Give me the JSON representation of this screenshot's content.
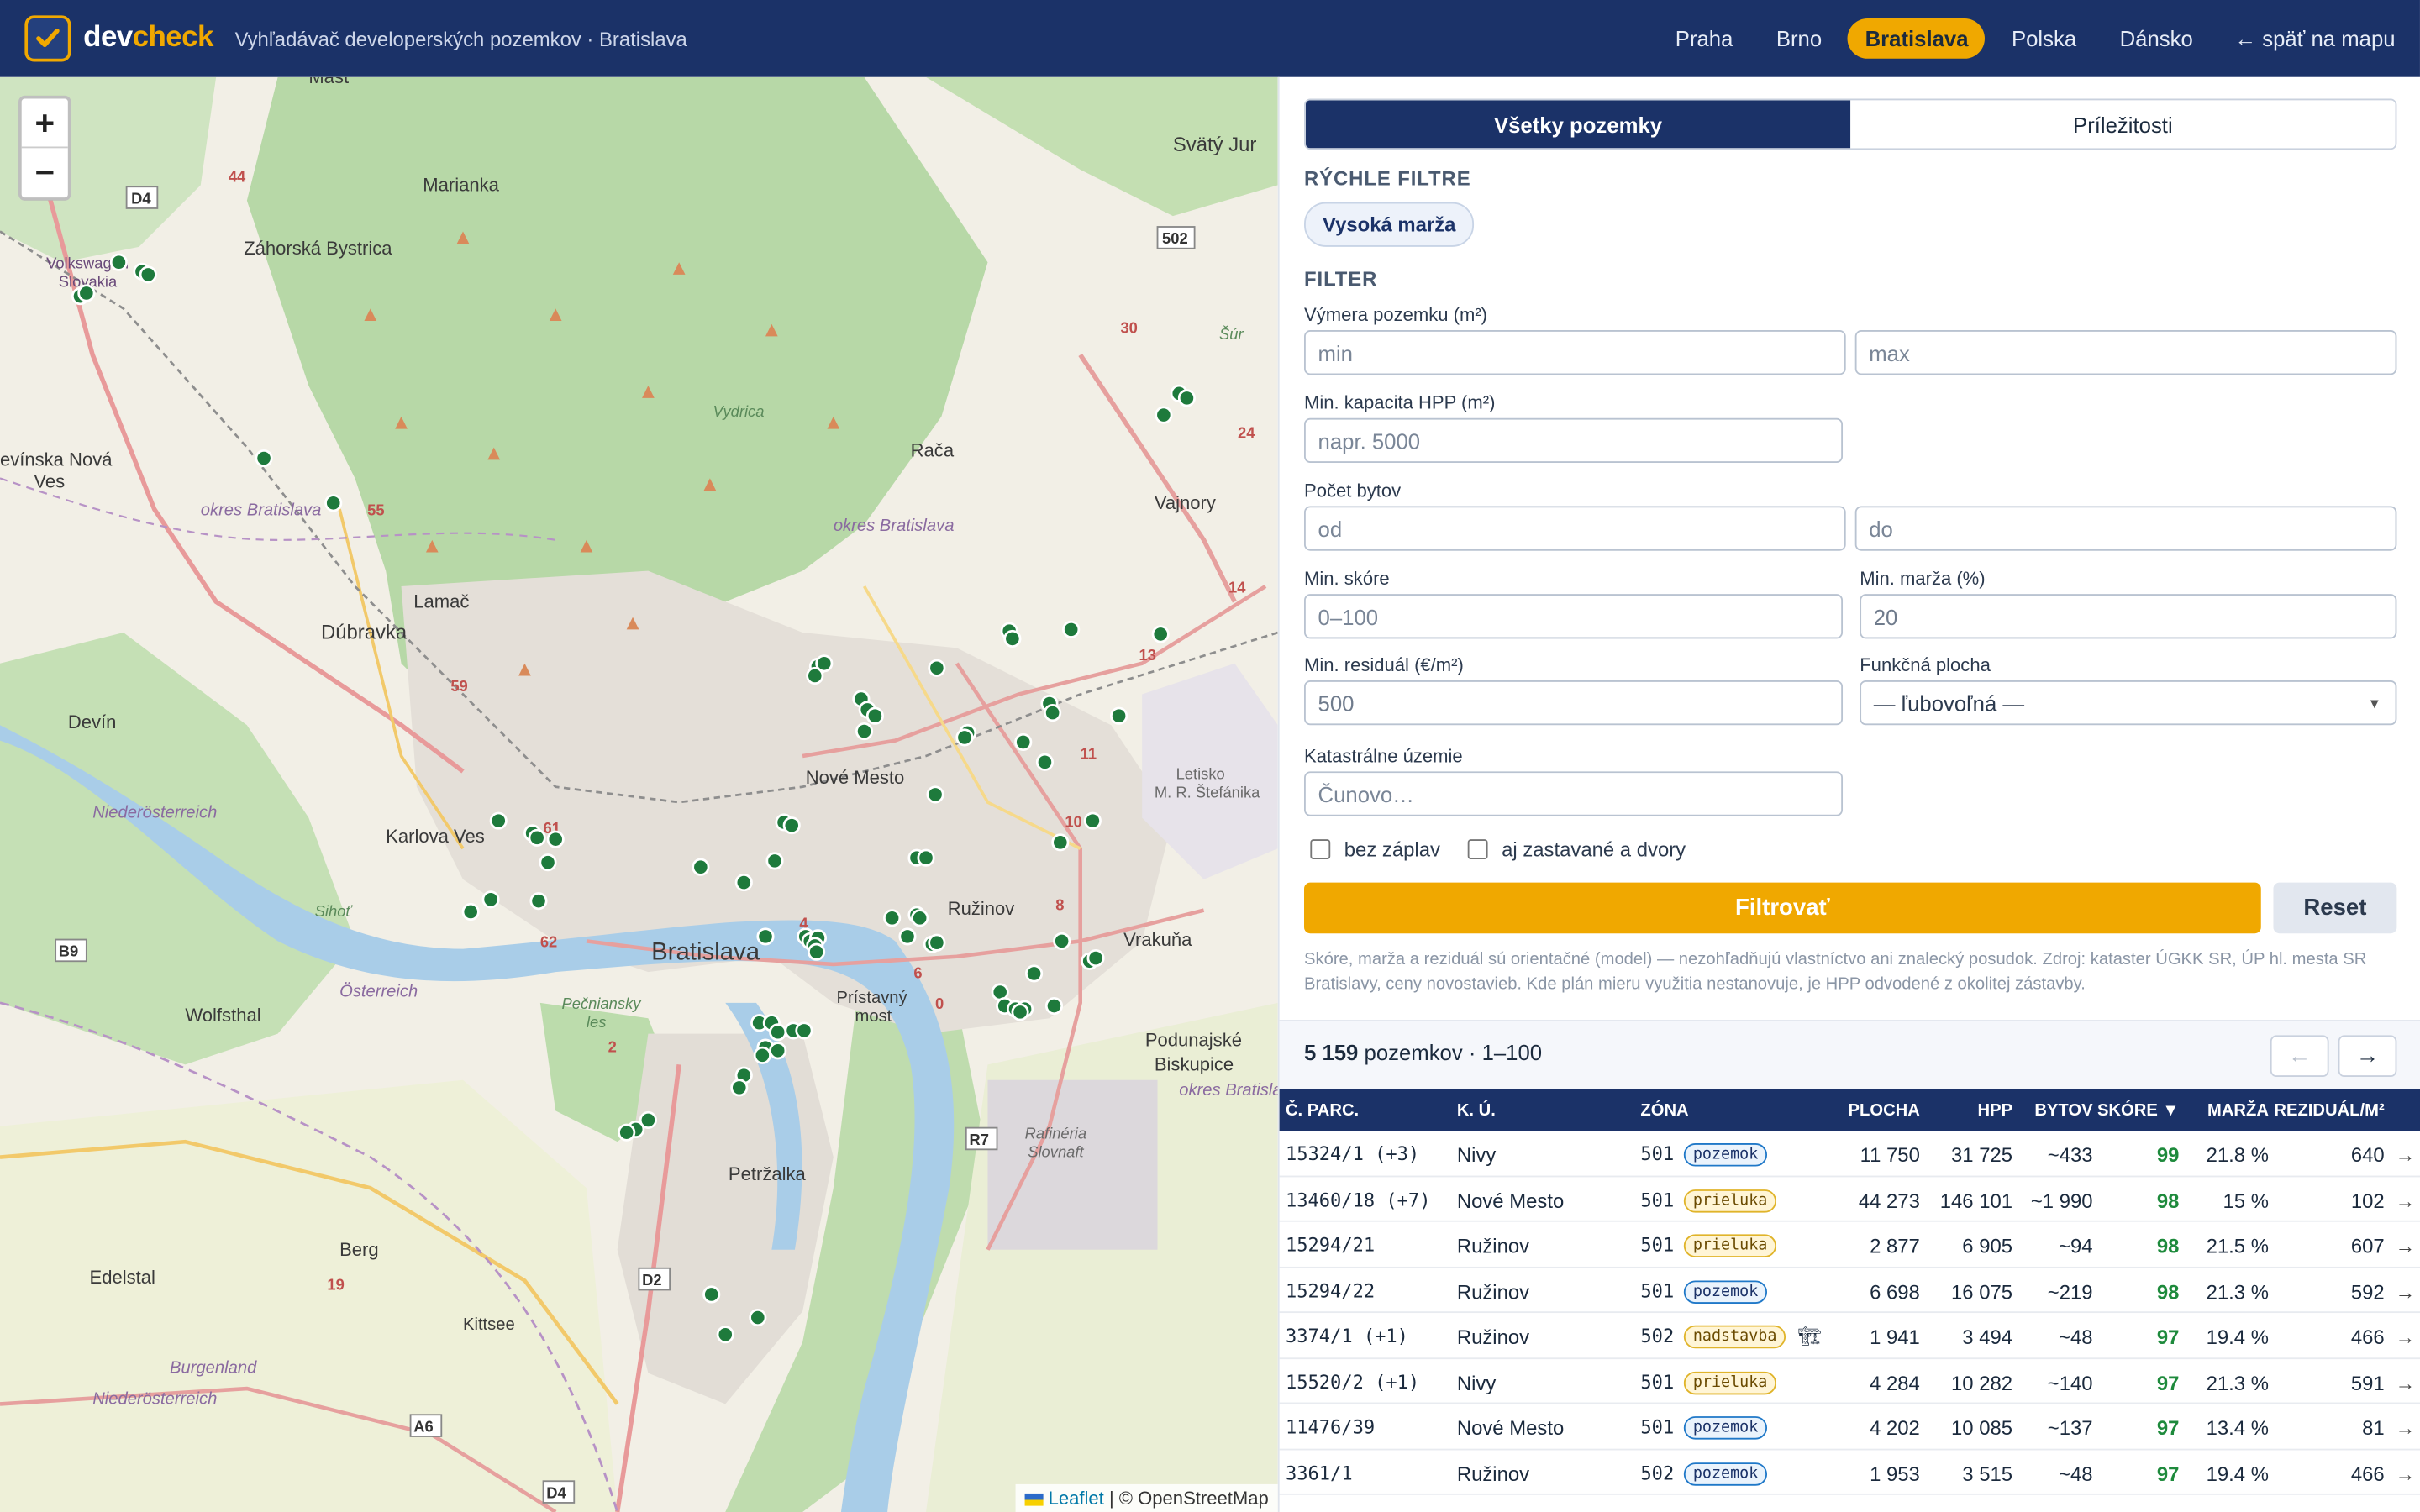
{
  "header": {
    "brand_dev": "dev",
    "brand_check": "check",
    "subtitle": "Vyhľadávač developerských pozemkov · Bratislava",
    "nav": [
      {
        "label": "Praha",
        "active": false
      },
      {
        "label": "Brno",
        "active": false
      },
      {
        "label": "Bratislava",
        "active": true
      },
      {
        "label": "Polska",
        "active": false
      },
      {
        "label": "Dánsko",
        "active": false
      }
    ],
    "back_label": "← späť na mapu"
  },
  "map": {
    "zoom_in": "+",
    "zoom_out": "−",
    "attribution_leaflet": "Leaflet",
    "attribution_rest": " | © OpenStreetMap",
    "places": [
      "Mast",
      "Marianka",
      "Záhorská Bystrica",
      "Svätý Jur",
      "Rača",
      "Vajnory",
      "Lamač",
      "Dúbravka",
      "Devín",
      "Karlova Ves",
      "Nové Mesto",
      "Bratislava",
      "Ružinov",
      "Vrakuňa",
      "Petržalka",
      "Podunajské Biskupice",
      "Prístavný most",
      "Wolfsthal",
      "Berg",
      "Edelstal",
      "Kittsee",
      "Devínska Nová Ves",
      "Volkswagen Slovakia",
      "okres Bratislava IV",
      "okres Bratislava III",
      "okres Bratislava II",
      "Vydrica",
      "Letisko M. R. Štefánika",
      "Sihoť",
      "Pečniansky les",
      "Rafinéria Slovnaft",
      "Niederösterreich",
      "Burgenland",
      "Österreich",
      "Šúr"
    ],
    "road_labels": [
      "D4",
      "44",
      "502",
      "30",
      "24",
      "55",
      "59",
      "61",
      "13",
      "14",
      "11",
      "10",
      "8",
      "6",
      "0",
      "2",
      "4",
      "62",
      "B9",
      "R7",
      "D2",
      "19",
      "A6"
    ],
    "marker_color": "#1e7a3c"
  },
  "panel": {
    "tabs": [
      {
        "label": "Všetky pozemky",
        "active": true
      },
      {
        "label": "Príležitosti",
        "active": false
      }
    ],
    "quick_filters_title": "RÝCHLE FILTRE",
    "quick_chip": "Vysoká marža",
    "filter_title": "FILTER",
    "fields": {
      "vymera_label": "Výmera pozemku (m²)",
      "vymera_min": "min",
      "vymera_max": "max",
      "hpp_label": "Min. kapacita HPP (m²)",
      "hpp_placeholder": "napr. 5000",
      "byty_label": "Počet bytov",
      "byty_od": "od",
      "byty_do": "do",
      "skore_label": "Min. skóre",
      "skore_placeholder": "0–100",
      "marza_label": "Min. marža (%)",
      "marza_value": "20",
      "rezidual_label": "Min. residuál (€/m²)",
      "rezidual_value": "500",
      "funkcna_label": "Funkčná plocha",
      "funkcna_value": "— ľubovoľná —",
      "kat_label": "Katastrálne územie",
      "kat_placeholder": "Čunovo…"
    },
    "checkbox_zaplavy": "bez záplav",
    "checkbox_zastavane": "aj zastavané a dvory",
    "btn_filter": "Filtrovať",
    "btn_reset": "Reset",
    "note": "Skóre, marža a reziduál sú orientačné (model) — nezohľadňujú vlastníctvo ani znalecký posudok. Zdroj: kataster ÚGKK SR, ÚP hl. mesta SR Bratislavy, ceny novostavieb. Kde plán mieru využitia nestanovuje, je HPP odvodené z okolitej zástavby.",
    "results_count": "5 159",
    "results_suffix": " pozemkov · 1–100",
    "prev": "←",
    "next": "→"
  },
  "table": {
    "headers": {
      "parc": "Č. PARC.",
      "ku": "K. Ú.",
      "zona": "ZÓNA",
      "plocha": "PLOCHA",
      "hpp": "HPP",
      "bytov": "BYTOV",
      "skore": "SKÓRE ▼",
      "marza": "MARŽA",
      "rezidual": "REZIDUÁL/M²"
    },
    "rows": [
      {
        "parc": "15324/1 (+3)",
        "ku": "Nivy",
        "zona": "501",
        "tag": "pozemok",
        "icon": "",
        "plocha": "11 750",
        "hpp": "31 725",
        "bytov": "~433",
        "skore": "99",
        "marza": "21.8 %",
        "rezidual": "640",
        "arrow": "→"
      },
      {
        "parc": "13460/18 (+7)",
        "ku": "Nové Mesto",
        "zona": "501",
        "tag": "prieluka",
        "icon": "",
        "plocha": "44 273",
        "hpp": "146 101",
        "bytov": "~1 990",
        "skore": "98",
        "marza": "15 %",
        "rezidual": "102",
        "arrow": "→"
      },
      {
        "parc": "15294/21",
        "ku": "Ružinov",
        "zona": "501",
        "tag": "prieluka",
        "icon": "",
        "plocha": "2 877",
        "hpp": "6 905",
        "bytov": "~94",
        "skore": "98",
        "marza": "21.5 %",
        "rezidual": "607",
        "arrow": "→"
      },
      {
        "parc": "15294/22",
        "ku": "Ružinov",
        "zona": "501",
        "tag": "pozemok",
        "icon": "",
        "plocha": "6 698",
        "hpp": "16 075",
        "bytov": "~219",
        "skore": "98",
        "marza": "21.3 %",
        "rezidual": "592",
        "arrow": "→"
      },
      {
        "parc": "3374/1 (+1)",
        "ku": "Ružinov",
        "zona": "502",
        "tag": "nadstavba",
        "icon": "🏗",
        "plocha": "1 941",
        "hpp": "3 494",
        "bytov": "~48",
        "skore": "97",
        "marza": "19.4 %",
        "rezidual": "466",
        "arrow": "→"
      },
      {
        "parc": "15520/2 (+1)",
        "ku": "Nivy",
        "zona": "501",
        "tag": "prieluka",
        "icon": "",
        "plocha": "4 284",
        "hpp": "10 282",
        "bytov": "~140",
        "skore": "97",
        "marza": "21.3 %",
        "rezidual": "591",
        "arrow": "→"
      },
      {
        "parc": "11476/39",
        "ku": "Nové Mesto",
        "zona": "501",
        "tag": "pozemok",
        "icon": "",
        "plocha": "4 202",
        "hpp": "10 085",
        "bytov": "~137",
        "skore": "97",
        "marza": "13.4 %",
        "rezidual": "81",
        "arrow": "→"
      },
      {
        "parc": "3361/1",
        "ku": "Ružinov",
        "zona": "502",
        "tag": "pozemok",
        "icon": "",
        "plocha": "1 953",
        "hpp": "3 515",
        "bytov": "~48",
        "skore": "97",
        "marza": "19.4 %",
        "rezidual": "466",
        "arrow": "→"
      }
    ]
  }
}
